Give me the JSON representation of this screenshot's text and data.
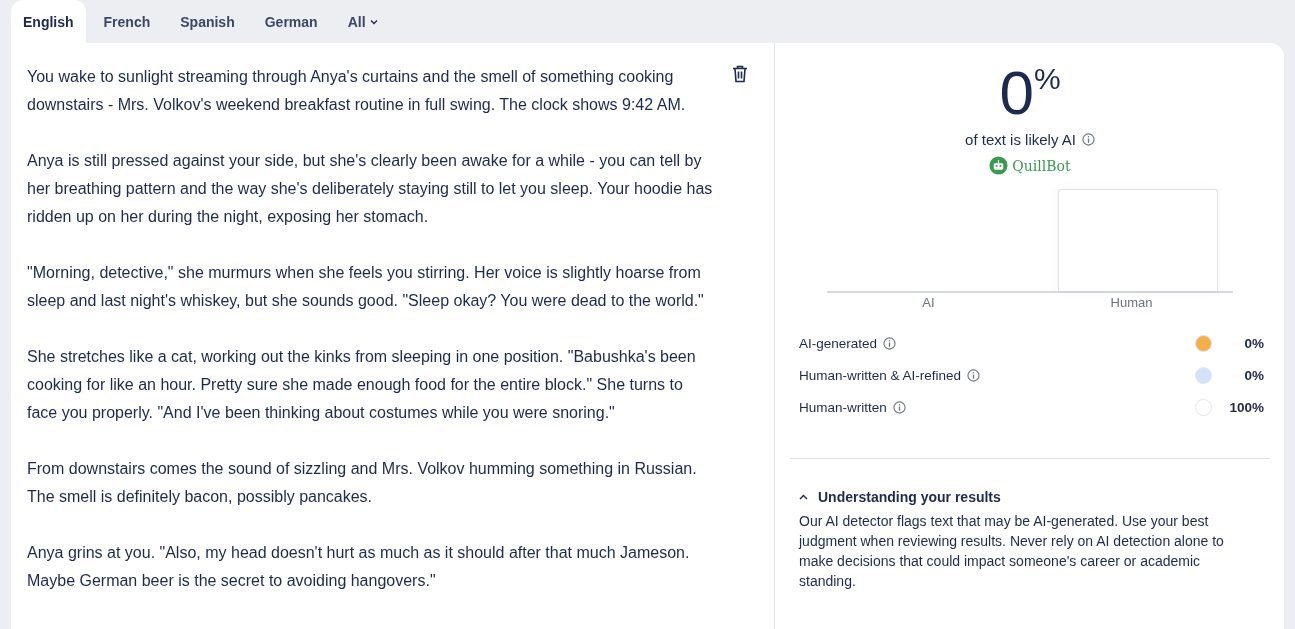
{
  "tabs": [
    {
      "label": "English",
      "selected": true
    },
    {
      "label": "French",
      "selected": false
    },
    {
      "label": "Spanish",
      "selected": false
    },
    {
      "label": "German",
      "selected": false
    },
    {
      "label": "All",
      "selected": false,
      "kind": "dropdown"
    }
  ],
  "text": [
    "You wake to sunlight streaming through Anya's curtains and the smell of something cooking downstairs - Mrs. Volkov's weekend breakfast routine in full swing. The clock shows 9:42 AM.",
    "Anya is still pressed against your side, but she's clearly been awake for a while - you can tell by her breathing pattern and the way she's deliberately staying still to let you sleep. Your hoodie has ridden up on her during the night, exposing her stomach.",
    "\"Morning, detective,\" she murmurs when she feels you stirring. Her voice is slightly hoarse from sleep and last night's whiskey, but she sounds good. \"Sleep okay? You were dead to the world.\"",
    "She stretches like a cat, working out the kinks from sleeping in one position. \"Babushka's been cooking for like an hour. Pretty sure she made enough food for the entire block.\" She turns to face you properly. \"And I've been thinking about costumes while you were snoring.\"",
    "From downstairs comes the sound of sizzling and Mrs. Volkov humming something in Russian. The smell is definitely bacon, possibly pancakes.",
    "Anya grins at you. \"Also, my head doesn't hurt as much as it should after that much Jameson. Maybe German beer is the secret to avoiding hangovers.\""
  ],
  "result": {
    "score": "0",
    "unit": "%",
    "caption": "of text is likely AI",
    "brand": "QuillBot"
  },
  "bars": [
    {
      "label": "AI",
      "kind": "empty"
    },
    {
      "label": "Human",
      "kind": "full"
    }
  ],
  "breakdown": [
    {
      "label": "AI-generated",
      "value": "0%",
      "color": "#f5ae4c"
    },
    {
      "label": "Human-written & AI-refined",
      "value": "0%",
      "color": "#d4e1fb"
    },
    {
      "label": "Human-written",
      "value": "100%",
      "color": "#ffffff"
    }
  ],
  "explainer": {
    "title": "Understanding your results",
    "expanded": true,
    "body": "Our AI detector flags text that may be AI-generated. Use your best judgment when reviewing results. Never rely on AI detection alone to make decisions that could impact someone's career or academic standing."
  }
}
